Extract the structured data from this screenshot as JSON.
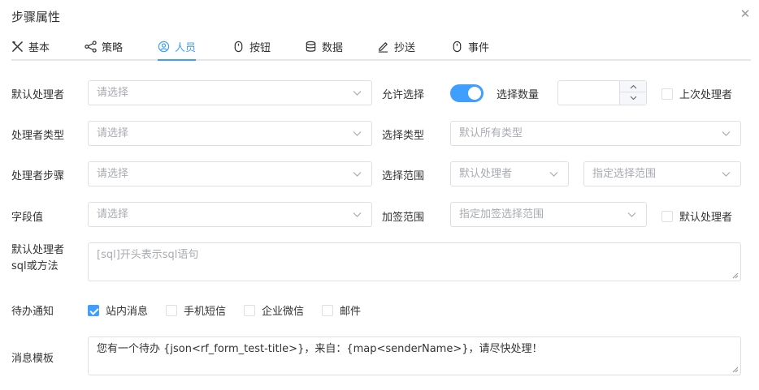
{
  "dialog": {
    "title": "步骤属性",
    "close_icon": "close-icon"
  },
  "tabs": [
    {
      "label": "基本",
      "icon": "tools-icon"
    },
    {
      "label": "策略",
      "icon": "share-icon"
    },
    {
      "label": "人员",
      "icon": "user-icon"
    },
    {
      "label": "按钮",
      "icon": "mouse-icon"
    },
    {
      "label": "数据",
      "icon": "database-icon"
    },
    {
      "label": "抄送",
      "icon": "edit-icon"
    },
    {
      "label": "事件",
      "icon": "mouse-icon"
    }
  ],
  "active_tab": "人员",
  "form": {
    "default_handler": {
      "label": "默认处理者",
      "placeholder": "请选择"
    },
    "allow_select": {
      "label": "允许选择",
      "on": true
    },
    "select_count": {
      "label": "选择数量",
      "value": ""
    },
    "last_handler": {
      "label": "上次处理者",
      "checked": false
    },
    "handler_type": {
      "label": "处理者类型",
      "placeholder": "请选择"
    },
    "select_type": {
      "label": "选择类型",
      "placeholder": "默认所有类型"
    },
    "handler_step": {
      "label": "处理者步骤",
      "placeholder": "请选择"
    },
    "select_range": {
      "label": "选择范围",
      "placeholder": "默认处理者",
      "placeholder2": "指定选择范围"
    },
    "field_value": {
      "label": "字段值",
      "placeholder": "请选择"
    },
    "addsign_range": {
      "label": "加签范围",
      "placeholder": "指定加签选择范围"
    },
    "default_handler_cb": {
      "label": "默认处理者",
      "checked": false
    },
    "sql_method": {
      "label_line1": "默认处理者",
      "label_line2": "sql或方法",
      "placeholder": "[sql]开头表示sql语句"
    },
    "todo_notify": {
      "label": "待办通知",
      "options": [
        {
          "label": "站内消息",
          "checked": true
        },
        {
          "label": "手机短信",
          "checked": false
        },
        {
          "label": "企业微信",
          "checked": false
        },
        {
          "label": "邮件",
          "checked": false
        }
      ]
    },
    "message_template": {
      "label": "消息模板",
      "value": "您有一个待办 {json<rf_form_test-title>}，来自：{map<senderName>}，请尽快处理！"
    }
  },
  "colors": {
    "accent": "#409eff",
    "border": "#dcdfe6",
    "placeholder": "#a8abb2"
  }
}
